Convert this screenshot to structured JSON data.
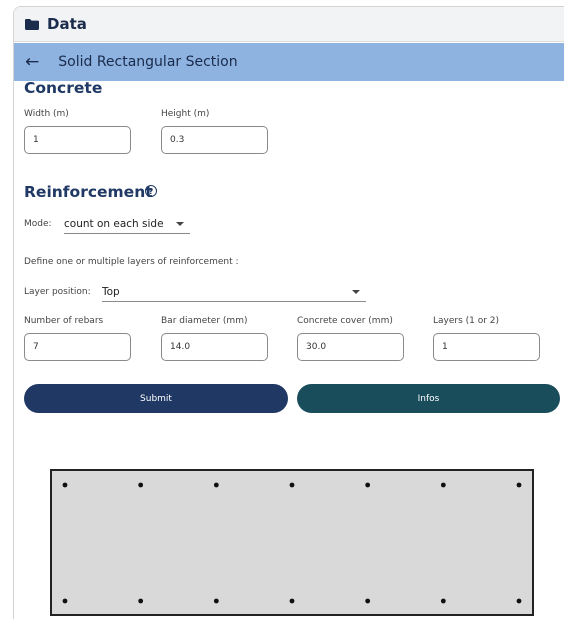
{
  "header": {
    "title": "Data",
    "folder_icon": "folder-icon"
  },
  "subheader": {
    "back_icon": "arrow-left-icon",
    "title": "Solid Rectangular Section"
  },
  "concrete": {
    "title": "Concrete",
    "width": {
      "label": "Width (m)",
      "value": "1"
    },
    "height": {
      "label": "Height (m)",
      "value": "0.3"
    }
  },
  "reinforcement": {
    "title": "Reinforcement",
    "help_icon": "?",
    "mode": {
      "label": "Mode:",
      "value": "count on each side"
    },
    "define_text": "Define one or multiple layers of reinforcement :",
    "layer_position": {
      "label": "Layer position:",
      "value": "Top"
    },
    "fields": {
      "rebars": {
        "label": "Number of rebars",
        "value": "7"
      },
      "diameter": {
        "label": "Bar diameter (mm)",
        "value": "14.0"
      },
      "cover": {
        "label": "Concrete cover (mm)",
        "value": "30.0"
      },
      "layers": {
        "label": "Layers (1 or 2)",
        "value": "1"
      }
    }
  },
  "buttons": {
    "submit": "Submit",
    "infos": "Infos"
  },
  "section_preview": {
    "fill_color": "#d9d9d9",
    "border_color": "#222222",
    "rebar_color": "#111111",
    "top_rebars": 7,
    "bottom_rebars": 7
  }
}
